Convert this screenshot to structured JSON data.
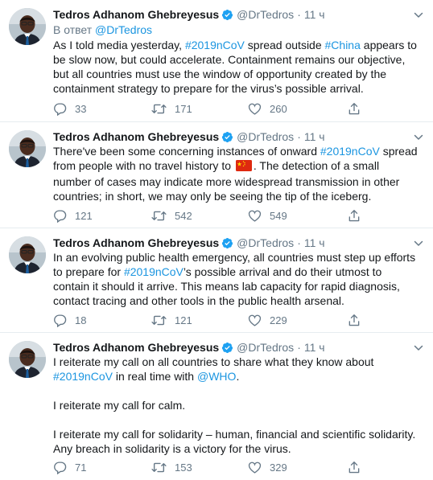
{
  "tweets": [
    {
      "name": "Tedros Adhanom Ghebreyesus",
      "handle": "@DrTedros",
      "separator": "·",
      "time": "11 ч",
      "reply_prefix": "В ответ",
      "reply_to": "@DrTedros",
      "text": [
        {
          "t": "As I told media yesterday, "
        },
        {
          "t": "#2019nCoV",
          "link": true
        },
        {
          "t": " spread outside "
        },
        {
          "t": "#China",
          "link": true
        },
        {
          "t": " appears to be slow now, but could accelerate. Containment remains our objective, but all countries must use the window of opportunity created by the containment strategy to prepare for the virus’s possible arrival."
        }
      ],
      "replies": "33",
      "retweets": "171",
      "likes": "260"
    },
    {
      "name": "Tedros Adhanom Ghebreyesus",
      "handle": "@DrTedros",
      "separator": "·",
      "time": "11 ч",
      "text": [
        {
          "t": "There've been some concerning instances of onward "
        },
        {
          "t": "#2019nCoV",
          "link": true
        },
        {
          "t": " spread from people with no travel history to "
        },
        {
          "flag": "china-flag-emoji"
        },
        {
          "t": ". The detection of a small number of cases may indicate more widespread transmission in other countries; in short, we may only be seeing the tip of the iceberg."
        }
      ],
      "replies": "121",
      "retweets": "542",
      "likes": "549"
    },
    {
      "name": "Tedros Adhanom Ghebreyesus",
      "handle": "@DrTedros",
      "separator": "·",
      "time": "11 ч",
      "text": [
        {
          "t": "In an evolving public health emergency, all countries must step up efforts to prepare for "
        },
        {
          "t": "#2019nCoV",
          "link": true
        },
        {
          "t": "’s possible arrival and do their utmost to contain it should it arrive. This means lab capacity for rapid diagnosis, contact tracing and other tools in the public health arsenal."
        }
      ],
      "replies": "18",
      "retweets": "121",
      "likes": "229"
    },
    {
      "name": "Tedros Adhanom Ghebreyesus",
      "handle": "@DrTedros",
      "separator": "·",
      "time": "11 ч",
      "text": [
        {
          "t": "I reiterate my call on all countries to share what they know about "
        },
        {
          "t": "#2019nCoV",
          "link": true
        },
        {
          "t": " in real time with "
        },
        {
          "t": "@WHO",
          "link": true
        },
        {
          "t": ".\n\nI reiterate my call for calm.\n\nI reiterate my call for solidarity – human, financial and scientific solidarity. Any breach in solidarity is a victory for the virus."
        }
      ],
      "replies": "71",
      "retweets": "153",
      "likes": "329"
    }
  ],
  "colors": {
    "link": "#1b95e0",
    "muted": "#657786",
    "text": "#14171a",
    "divider": "#e6ecf0"
  }
}
